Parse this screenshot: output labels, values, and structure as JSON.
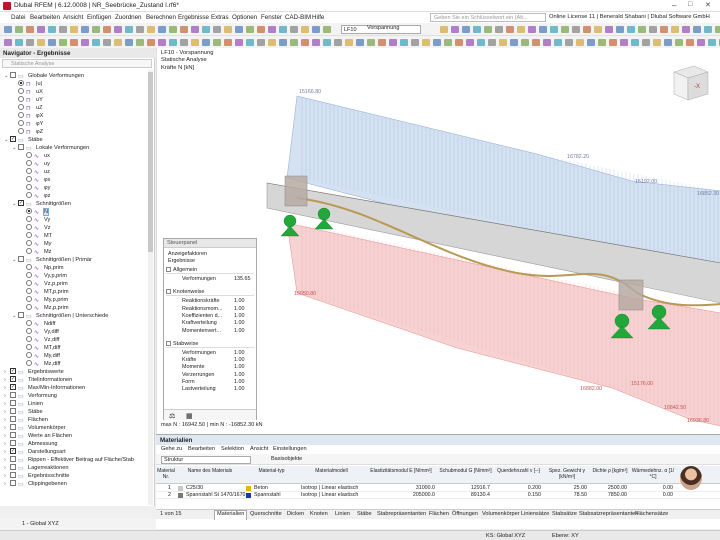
{
  "titlebar": {
    "title": "Dlubal RFEM | 6.12.0008 | NR_Seebrücke_Zustand I.rf6*",
    "min": "–",
    "max": "□",
    "close": "✕"
  },
  "menu": [
    "Datei",
    "Bearbeiten",
    "Ansicht",
    "Einfügen",
    "Zuordnen",
    "Berechnen",
    "Ergebnisse",
    "Extras",
    "Optionen",
    "Fenster",
    "CAD-BIM",
    "Hilfe"
  ],
  "search": {
    "placeholder": "Geben Sie ein Schlüsselwort ein (Alt..."
  },
  "license": "Online License 11 | Benerald Shabani | Dlubal Software GmbH",
  "toolbar": {
    "loadcase_id": "LF10",
    "loadcase_name": "Vorspannung"
  },
  "navigator": {
    "title": "Navigator - Ergebnisse",
    "subtitle": "Statische Analyse",
    "items": [
      {
        "label": "Globale Verformungen",
        "lvl": 0,
        "kind": "cb",
        "exp": "⌄",
        "on": false
      },
      {
        "label": "|u|",
        "lvl": 1,
        "kind": "rb",
        "on": true,
        "icon": "u"
      },
      {
        "label": "uX",
        "lvl": 1,
        "kind": "rb",
        "on": false,
        "icon": "u"
      },
      {
        "label": "uY",
        "lvl": 1,
        "kind": "rb",
        "on": false,
        "icon": "u"
      },
      {
        "label": "uZ",
        "lvl": 1,
        "kind": "rb",
        "on": false,
        "icon": "u"
      },
      {
        "label": "φX",
        "lvl": 1,
        "kind": "rb",
        "on": false,
        "icon": "u"
      },
      {
        "label": "φY",
        "lvl": 1,
        "kind": "rb",
        "on": false,
        "icon": "u"
      },
      {
        "label": "φZ",
        "lvl": 1,
        "kind": "rb",
        "on": false,
        "icon": "u"
      },
      {
        "label": "Stäbe",
        "lvl": 0,
        "kind": "cb",
        "exp": "⌄",
        "on": true
      },
      {
        "label": "Lokale Verformungen",
        "lvl": 1,
        "kind": "cb",
        "exp": "⌄",
        "on": false
      },
      {
        "label": "ux",
        "lvl": 2,
        "kind": "rb",
        "on": false,
        "icon": "s"
      },
      {
        "label": "uy",
        "lvl": 2,
        "kind": "rb",
        "on": false,
        "icon": "s"
      },
      {
        "label": "uz",
        "lvl": 2,
        "kind": "rb",
        "on": false,
        "icon": "s"
      },
      {
        "label": "φx",
        "lvl": 2,
        "kind": "rb",
        "on": false,
        "icon": "s"
      },
      {
        "label": "φy",
        "lvl": 2,
        "kind": "rb",
        "on": false,
        "icon": "s"
      },
      {
        "label": "φz",
        "lvl": 2,
        "kind": "rb",
        "on": false,
        "icon": "s"
      },
      {
        "label": "Schnittgrößen",
        "lvl": 1,
        "kind": "cb",
        "exp": "⌄",
        "on": true
      },
      {
        "label": "N",
        "lvl": 2,
        "kind": "rb",
        "on": true,
        "icon": "s",
        "sel": true
      },
      {
        "label": "Vy",
        "lvl": 2,
        "kind": "rb",
        "on": false,
        "icon": "s"
      },
      {
        "label": "Vz",
        "lvl": 2,
        "kind": "rb",
        "on": false,
        "icon": "s"
      },
      {
        "label": "MT",
        "lvl": 2,
        "kind": "rb",
        "on": false,
        "icon": "s"
      },
      {
        "label": "My",
        "lvl": 2,
        "kind": "rb",
        "on": false,
        "icon": "s"
      },
      {
        "label": "Mz",
        "lvl": 2,
        "kind": "rb",
        "on": false,
        "icon": "s"
      },
      {
        "label": "Schnittgrößen | Primär",
        "lvl": 1,
        "kind": "cb",
        "exp": "⌄",
        "on": false
      },
      {
        "label": "Np,prim",
        "lvl": 2,
        "kind": "rb",
        "on": false,
        "icon": "s"
      },
      {
        "label": "Vy,p,prim",
        "lvl": 2,
        "kind": "rb",
        "on": false,
        "icon": "s"
      },
      {
        "label": "Vz,p,prim",
        "lvl": 2,
        "kind": "rb",
        "on": false,
        "icon": "s"
      },
      {
        "label": "MT,p,prim",
        "lvl": 2,
        "kind": "rb",
        "on": false,
        "icon": "s"
      },
      {
        "label": "My,p,prim",
        "lvl": 2,
        "kind": "rb",
        "on": false,
        "icon": "s"
      },
      {
        "label": "Mz,p,prim",
        "lvl": 2,
        "kind": "rb",
        "on": false,
        "icon": "s"
      },
      {
        "label": "Schnittgrößen | Unterschiede",
        "lvl": 1,
        "kind": "cb",
        "exp": "⌄",
        "on": false
      },
      {
        "label": "Ndiff",
        "lvl": 2,
        "kind": "rb",
        "on": false,
        "icon": "s"
      },
      {
        "label": "Vy,diff",
        "lvl": 2,
        "kind": "rb",
        "on": false,
        "icon": "s"
      },
      {
        "label": "Vz,diff",
        "lvl": 2,
        "kind": "rb",
        "on": false,
        "icon": "s"
      },
      {
        "label": "MT,diff",
        "lvl": 2,
        "kind": "rb",
        "on": false,
        "icon": "s"
      },
      {
        "label": "My,diff",
        "lvl": 2,
        "kind": "rb",
        "on": false,
        "icon": "s"
      },
      {
        "label": "Mz,diff",
        "lvl": 2,
        "kind": "rb",
        "on": false,
        "icon": "s"
      },
      {
        "label": "Ergebniswerte",
        "lvl": 0,
        "kind": "cb",
        "exp": "›",
        "on": true
      },
      {
        "label": "Titelinformationen",
        "lvl": 0,
        "kind": "cb",
        "exp": "›",
        "on": true
      },
      {
        "label": "Max/Min-Informationen",
        "lvl": 0,
        "kind": "cb",
        "exp": "›",
        "on": true
      },
      {
        "label": "Verformung",
        "lvl": 0,
        "kind": "cb",
        "exp": "›",
        "on": false
      },
      {
        "label": "Linien",
        "lvl": 0,
        "kind": "cb",
        "exp": "›",
        "on": false
      },
      {
        "label": "Stäbe",
        "lvl": 0,
        "kind": "cb",
        "exp": "›",
        "on": false
      },
      {
        "label": "Flächen",
        "lvl": 0,
        "kind": "cb",
        "exp": "›",
        "on": false
      },
      {
        "label": "Volumenkörper",
        "lvl": 0,
        "kind": "cb",
        "exp": "›",
        "on": false
      },
      {
        "label": "Werte an Flächen",
        "lvl": 0,
        "kind": "cb",
        "exp": "›",
        "on": false
      },
      {
        "label": "Abmessung",
        "lvl": 0,
        "kind": "cb",
        "exp": "›",
        "on": false
      },
      {
        "label": "Darstellungsart",
        "lvl": 0,
        "kind": "cb",
        "exp": "›",
        "on": true
      },
      {
        "label": "Rippen - Effektiver Beitrag auf Fläche/Stab",
        "lvl": 0,
        "kind": "cb",
        "exp": "›",
        "on": false
      },
      {
        "label": "Lagerreaktionen",
        "lvl": 0,
        "kind": "cb",
        "exp": "›",
        "on": false
      },
      {
        "label": "Ergebnisschnitte",
        "lvl": 0,
        "kind": "cb",
        "exp": "›",
        "on": false
      },
      {
        "label": "Clippingebenen",
        "lvl": 0,
        "kind": "cb",
        "exp": "›",
        "on": false
      }
    ]
  },
  "viewport": {
    "info_lines": [
      "LF10 - Vorspannung",
      "Statische Analyse",
      "Kräfte N [kN]"
    ],
    "maxmin": "max N : 16942.50 | min N : -16852.30 kN",
    "labels_top": [
      "15166.80",
      "16782.20",
      "15192.00",
      "16852.30"
    ],
    "labels_bottom": [
      "15050.80",
      "16882.00",
      "15176.00",
      "16842.50",
      "16936.80"
    ],
    "cube_label": "-X"
  },
  "steuerpanel": {
    "title": "Steuerpanel",
    "subtitle1": "Anzeigefaktoren",
    "subtitle2": "Ergebnisse",
    "sections": [
      {
        "name": "Allgemein",
        "rows": [
          [
            "Verformungen",
            "135.65"
          ]
        ]
      },
      {
        "name": "Knotenweise",
        "rows": [
          [
            "Reaktionskräfte",
            "1.00"
          ],
          [
            "Reaktionsmom...",
            "1.00"
          ],
          [
            "Koeffizienten d...",
            "1.00"
          ],
          [
            "Kraftverteilung",
            "1.00"
          ],
          [
            "Momentenvert...",
            "1.00"
          ]
        ]
      },
      {
        "name": "Stabweise",
        "rows": [
          [
            "Verformungen",
            "1.00"
          ],
          [
            "Kräfte",
            "1.00"
          ],
          [
            "Momente",
            "1.00"
          ],
          [
            "Verzerrungen",
            "1.00"
          ],
          [
            "Form",
            "1.00"
          ],
          [
            "Lastverteilung",
            "1.00"
          ]
        ]
      }
    ]
  },
  "materials": {
    "title": "Materialien",
    "menu": [
      "Gehe zu",
      "Bearbeiten",
      "Selektion",
      "Ansicht",
      "Einstellungen"
    ],
    "filter": "Struktur",
    "filter2": "Basisobjekte",
    "headers": [
      "Material Nr.",
      "Name des Materials",
      "Material-typ",
      "Materialmodell",
      "Elastizitätsmodul E [N/mm²]",
      "Schubmodul G [N/mm²]",
      "Querdehnzahl ν [--]",
      "Spez. Gewicht γ [kN/m³]",
      "Dichte ρ [kg/m³]",
      "Wärmedehnz. α [1/°C]"
    ],
    "rows": [
      [
        "1",
        "C25/30",
        "Beton",
        "Isotrop | Linear elastisch",
        "31000.0",
        "12916.7",
        "0.200",
        "25.00",
        "2500.00",
        "0.00"
      ],
      [
        "2",
        "Spannstahl St 1470/1670",
        "Spannstahl",
        "Isotrop | Linear elastisch",
        "205000.0",
        "89130.4",
        "0.150",
        "78.50",
        "7850.00",
        "0.00"
      ]
    ],
    "row_colors": [
      "#c8c8c8",
      "#7a7a6e"
    ],
    "type_colors": [
      "#e8b400",
      "#1a3c9e"
    ],
    "pager": "1 von 15"
  },
  "tabs": [
    "Materialien",
    "Querschnitte",
    "Dicken",
    "Knoten",
    "Linien",
    "Stäbe",
    "Stabrepräsentanten",
    "Flächen",
    "Öffnungen",
    "Volumenkörper",
    "Liniensätze",
    "Stabsätze",
    "Stabsatzrepräsentanten",
    "Flächensätze"
  ],
  "status": {
    "cs": "1 - Global XYZ",
    "ks": "KS: Global XYZ",
    "plane": "Ebene: XY"
  }
}
